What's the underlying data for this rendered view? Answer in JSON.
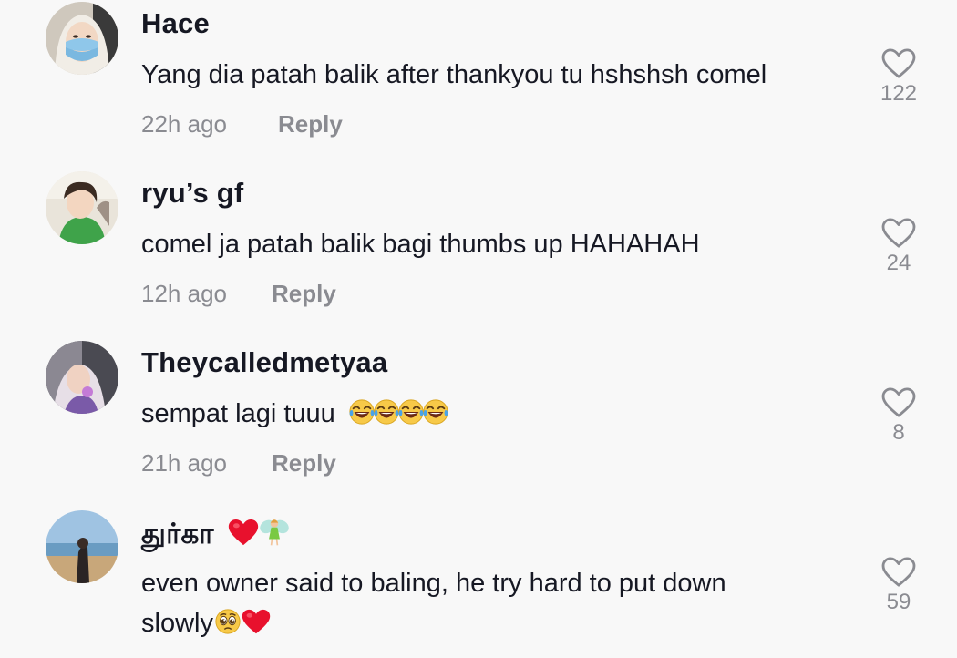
{
  "comments": [
    {
      "username": "Hace",
      "text": "Yang dia patah balik after thankyou tu hshshsh comel",
      "time": "22h ago",
      "reply": "Reply",
      "likes": "122"
    },
    {
      "username": "ryu’s gf",
      "text": "comel ja patah balik bagi thumbs up HAHAHAH",
      "time": "12h ago",
      "reply": "Reply",
      "likes": "24"
    },
    {
      "username": "Theycalledmetyaa",
      "text": "sempat lagi tuuu",
      "time": "21h ago",
      "reply": "Reply",
      "likes": "8"
    },
    {
      "username": "துர்கா",
      "text_line1": "even owner said to baling, he try hard to put down",
      "text_line2": "slowly",
      "likes": "59"
    }
  ],
  "icons": {
    "like": "heart-outline-icon",
    "laugh": "tears-of-joy-emoji",
    "heart": "red-heart-emoji",
    "fairy": "fairy-emoji",
    "pleading": "pleading-face-emoji"
  },
  "colors": {
    "background": "#f8f8f8",
    "text": "#161823",
    "muted": "#8a8b91",
    "heart": "#e8112d"
  }
}
